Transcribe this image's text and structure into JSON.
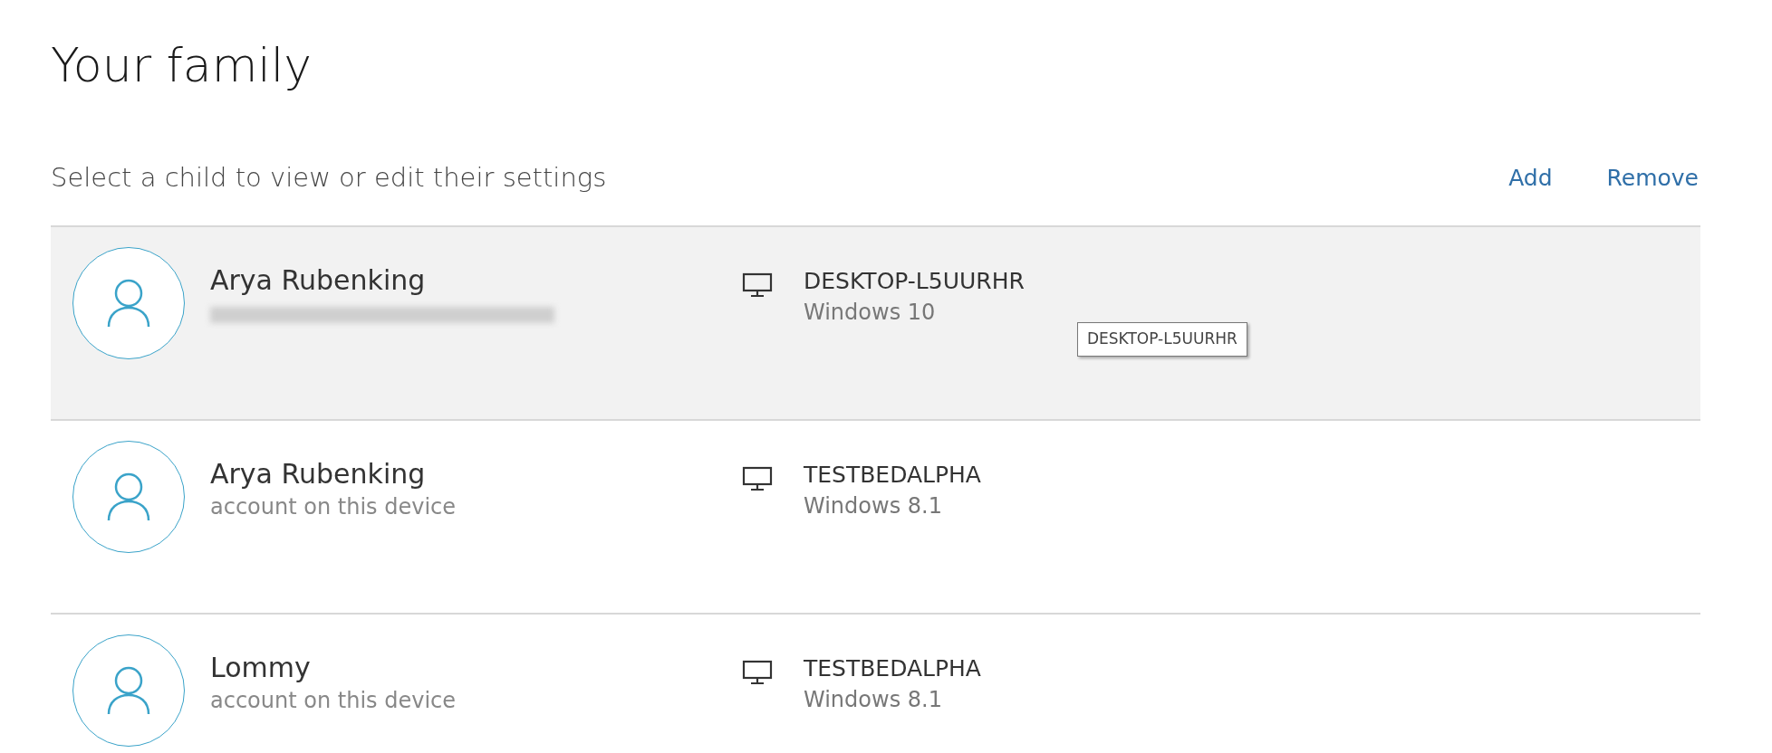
{
  "title": "Your family",
  "subtitle": "Select a child to view or edit their settings",
  "actions": [
    "Add",
    "Remove"
  ],
  "children": [
    {
      "name": "Arya Rubenking",
      "detail_redacted": true,
      "device": "DESKTOP-L5UURHR",
      "os": "Windows 10",
      "selected": true
    },
    {
      "name": "Arya Rubenking",
      "detail_redacted": false,
      "detail": "account on this device",
      "device": "TESTBEDALPHA",
      "os": "Windows 8.1",
      "selected": false
    },
    {
      "name": "Lommy",
      "detail_redacted": false,
      "detail": "account on this device",
      "device": "TESTBEDALPHA",
      "os": "Windows 8.1",
      "selected": false
    }
  ],
  "tooltip": {
    "text": "DESKTOP-L5UURHR"
  }
}
